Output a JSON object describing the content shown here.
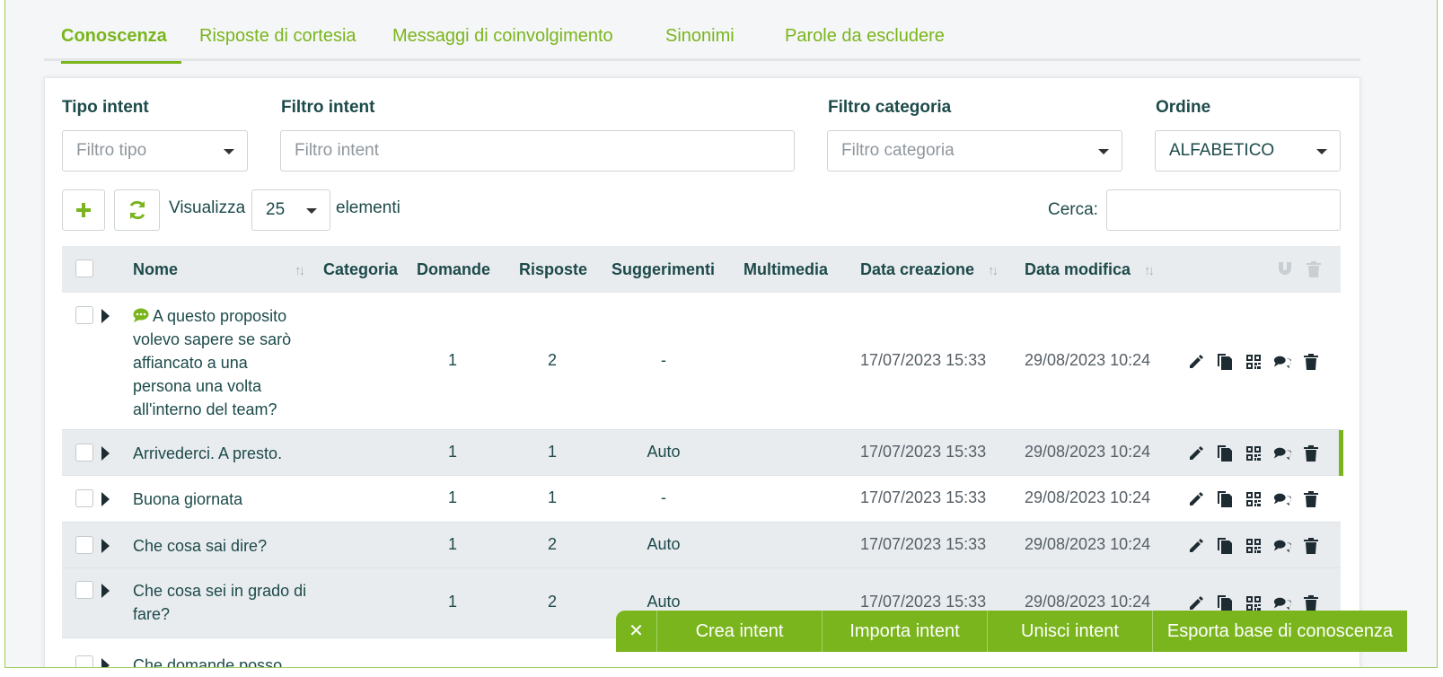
{
  "tabs": [
    {
      "label": "Conoscenza",
      "active": true
    },
    {
      "label": "Risposte di cortesia"
    },
    {
      "label": "Messaggi di coinvolgimento"
    },
    {
      "label": "Sinonimi"
    },
    {
      "label": "Parole da escludere"
    }
  ],
  "filters": {
    "type": {
      "label": "Tipo intent",
      "placeholder": "Filtro tipo"
    },
    "intent": {
      "label": "Filtro intent",
      "placeholder": "Filtro intent"
    },
    "category": {
      "label": "Filtro categoria",
      "placeholder": "Filtro categoria"
    },
    "order": {
      "label": "Ordine",
      "value": "ALFABETICO"
    }
  },
  "toolbar": {
    "show_label": "Visualizza",
    "page_size": "25",
    "items_label": "elementi",
    "search_label": "Cerca:"
  },
  "table": {
    "headers": {
      "name": "Nome",
      "category": "Categoria",
      "questions": "Domande",
      "answers": "Risposte",
      "suggestions": "Suggerimenti",
      "multimedia": "Multimedia",
      "created": "Data creazione",
      "modified": "Data modifica"
    },
    "rows": [
      {
        "name_lines": [
          "A questo proposito",
          "volevo sapere se sarò",
          "affiancato a una",
          "persona una volta",
          "all'interno del team?"
        ],
        "questions": "1",
        "answers": "2",
        "suggestions": "-",
        "created": "17/07/2023 15:33",
        "modified": "29/08/2023 10:24"
      },
      {
        "name_lines": [
          "Arrivederci. A presto."
        ],
        "questions": "1",
        "answers": "1",
        "suggestions": "Auto",
        "created": "17/07/2023 15:33",
        "modified": "29/08/2023 10:24"
      },
      {
        "name_lines": [
          "Buona giornata"
        ],
        "questions": "1",
        "answers": "1",
        "suggestions": "-",
        "created": "17/07/2023 15:33",
        "modified": "29/08/2023 10:24"
      },
      {
        "name_lines": [
          "Che cosa sai dire?"
        ],
        "questions": "1",
        "answers": "2",
        "suggestions": "Auto",
        "created": "17/07/2023 15:33",
        "modified": "29/08/2023 10:24"
      },
      {
        "name_lines": [
          "Che cosa sei in grado di",
          "fare?"
        ],
        "questions": "1",
        "answers": "2",
        "suggestions": "Auto",
        "created": "17/07/2023 15:33",
        "modified": "29/08/2023 10:24"
      },
      {
        "name_lines": [
          "Che domande posso"
        ],
        "questions": "",
        "answers": "",
        "suggestions": "",
        "created": "",
        "modified": ""
      }
    ]
  },
  "action_bar": {
    "close_glyph": "✕",
    "create": "Crea intent",
    "import": "Importa intent",
    "merge": "Unisci intent",
    "export": "Esporta base di conoscenza"
  },
  "colors": {
    "accent": "#7ab51d",
    "text": "#1d4a4a",
    "header_bg": "#e9ecef"
  }
}
